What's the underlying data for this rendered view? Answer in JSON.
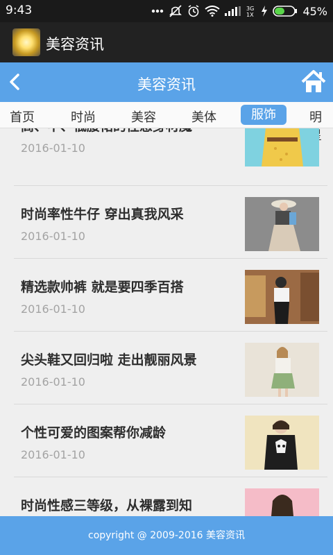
{
  "status": {
    "time": "9:43",
    "network": "3G\n1X",
    "battery": "45%"
  },
  "app": {
    "title": "美容资讯"
  },
  "header": {
    "title": "美容资讯"
  },
  "tabs": [
    {
      "label": "首页"
    },
    {
      "label": "时尚"
    },
    {
      "label": "美容"
    },
    {
      "label": "美体"
    },
    {
      "label": "服饰",
      "active": true
    },
    {
      "label": "明星"
    }
  ],
  "articles": [
    {
      "title": "高、中、低腰裙的性感身材魔",
      "date": "2016-01-10"
    },
    {
      "title": "时尚率性牛仔 穿出真我风采",
      "date": "2016-01-10"
    },
    {
      "title": "精选款帅裤 就是要四季百搭",
      "date": "2016-01-10"
    },
    {
      "title": "尖头鞋又回归啦 走出靓丽风景",
      "date": "2016-01-10"
    },
    {
      "title": "个性可爱的图案帮你减龄",
      "date": "2016-01-10"
    },
    {
      "title": "时尚性感三等级，从裸露到知",
      "date": ""
    }
  ],
  "footer": {
    "text": "copyright @ 2009-2016 美容资讯"
  },
  "colors": {
    "accent": "#5aa3e8",
    "statusbar": "#1a1a1a",
    "appbar": "#222222"
  }
}
